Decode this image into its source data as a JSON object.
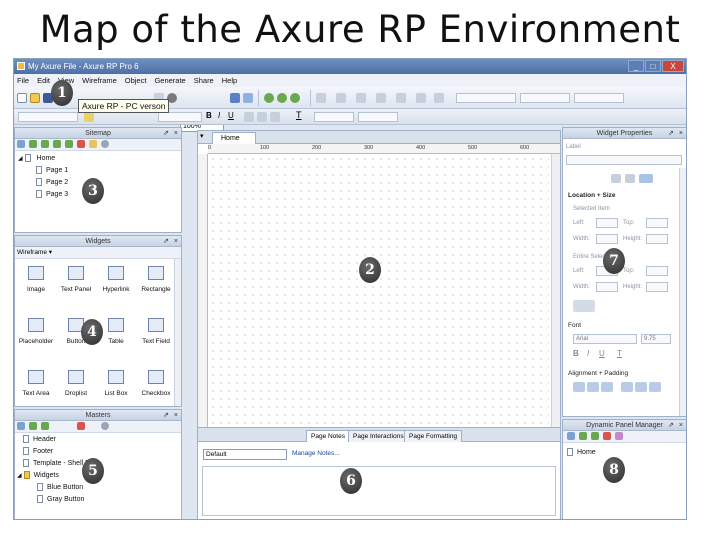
{
  "slide_title": "Map of the Axure RP Environment",
  "window": {
    "title": "My Axure File - Axure RP Pro 6",
    "controls": [
      "_",
      "□",
      "X"
    ]
  },
  "menu": [
    "File",
    "Edit",
    "View",
    "Wireframe",
    "Object",
    "Generate",
    "Share",
    "Help"
  ],
  "toolbar": {
    "zoom": "100%",
    "tooltip": "Axure RP - PC verson"
  },
  "sitemap": {
    "title": "Sitemap",
    "root": "Home",
    "pages": [
      "Page 1",
      "Page 2",
      "Page 3"
    ]
  },
  "widgets": {
    "title": "Widgets",
    "library": "Wireframe",
    "items": [
      {
        "label": "Image",
        "icon": "image-icon"
      },
      {
        "label": "Text Panel",
        "icon": "text-panel-icon"
      },
      {
        "label": "Hyperlink",
        "icon": "hyperlink-icon"
      },
      {
        "label": "Rectangle",
        "icon": "rectangle-icon"
      },
      {
        "label": "Placeholder",
        "icon": "placeholder-icon"
      },
      {
        "label": "Button",
        "icon": "button-icon"
      },
      {
        "label": "Table",
        "icon": "table-icon"
      },
      {
        "label": "Text Field",
        "icon": "text-field-icon"
      },
      {
        "label": "Text Area",
        "icon": "text-area-icon"
      },
      {
        "label": "Droplist",
        "icon": "droplist-icon"
      },
      {
        "label": "List Box",
        "icon": "list-box-icon"
      },
      {
        "label": "Checkbox",
        "icon": "checkbox-icon"
      }
    ]
  },
  "masters": {
    "title": "Masters",
    "items": [
      "Header",
      "Footer",
      "Template - Shell P"
    ],
    "folder": "Widgets",
    "folder_items": [
      "Blue Button",
      "Gray Button"
    ]
  },
  "canvas": {
    "tab": "Home",
    "ruler_marks": [
      "0",
      "100",
      "200",
      "300",
      "400",
      "500",
      "600"
    ]
  },
  "page_notes": {
    "tabs": [
      "Page Notes",
      "Page Interactions",
      "Page Formatting"
    ],
    "select": "Default",
    "manage_link": "Manage Notes..."
  },
  "widget_properties": {
    "title": "Widget Properties",
    "label_field": "Label",
    "section_location": "Location + Size",
    "selected_item": "Selected Item",
    "left": "Left:",
    "top": "Top:",
    "width": "Width:",
    "height": "Height:",
    "entire_selection": "Entire Selection",
    "section_font": "Font",
    "font_name": "Arial",
    "font_size": "9.75",
    "section_alignment": "Alignment + Padding"
  },
  "dynamic_panel": {
    "title": "Dynamic Panel Manager",
    "item": "Home"
  },
  "callouts": [
    "1",
    "2",
    "3",
    "4",
    "5",
    "6",
    "7",
    "8"
  ]
}
